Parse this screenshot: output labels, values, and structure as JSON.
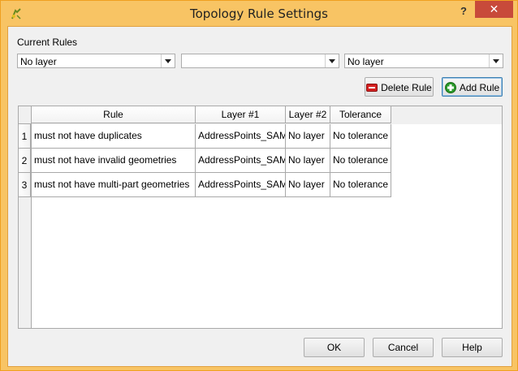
{
  "window": {
    "title": "Topology Rule Settings",
    "help_glyph": "?",
    "close_glyph": "✕",
    "accent_color": "#f8c464"
  },
  "current_rules": {
    "label": "Current Rules",
    "combo1_value": "No layer",
    "combo2_value": "",
    "combo3_value": "No layer"
  },
  "actions": {
    "delete_label": "Delete Rule",
    "add_label": "Add Rule"
  },
  "table": {
    "headers": [
      "Rule",
      "Layer #1",
      "Layer #2",
      "Tolerance"
    ],
    "rows": [
      {
        "num": "1",
        "rule": "must not have duplicates",
        "layer1": "AddressPoints_SAM",
        "layer2": "No layer",
        "tolerance": "No tolerance"
      },
      {
        "num": "2",
        "rule": "must not have invalid geometries",
        "layer1": "AddressPoints_SAM",
        "layer2": "No layer",
        "tolerance": "No tolerance"
      },
      {
        "num": "3",
        "rule": "must not have multi-part geometries",
        "layer1": "AddressPoints_SAM",
        "layer2": "No layer",
        "tolerance": "No tolerance"
      }
    ]
  },
  "footer": {
    "ok_label": "OK",
    "cancel_label": "Cancel",
    "help_label": "Help"
  }
}
